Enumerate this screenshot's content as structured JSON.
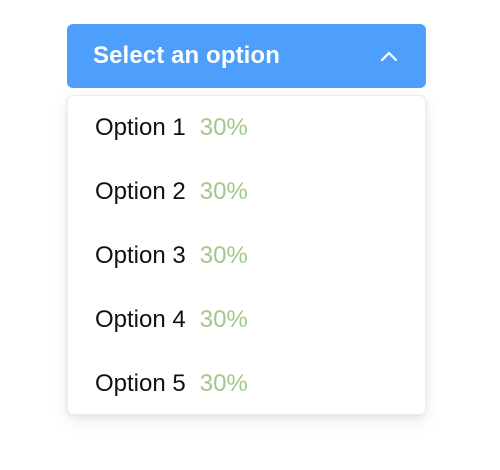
{
  "select": {
    "label": "Select an option",
    "icon": "chevron-up-icon"
  },
  "colors": {
    "accent": "#4d9ffb",
    "value": "#a2c68b",
    "text": "#111111"
  },
  "options": [
    {
      "label": "Option 1",
      "value": "30%"
    },
    {
      "label": "Option 2",
      "value": "30%"
    },
    {
      "label": "Option 3",
      "value": "30%"
    },
    {
      "label": "Option 4",
      "value": "30%"
    },
    {
      "label": "Option 5",
      "value": "30%"
    }
  ]
}
